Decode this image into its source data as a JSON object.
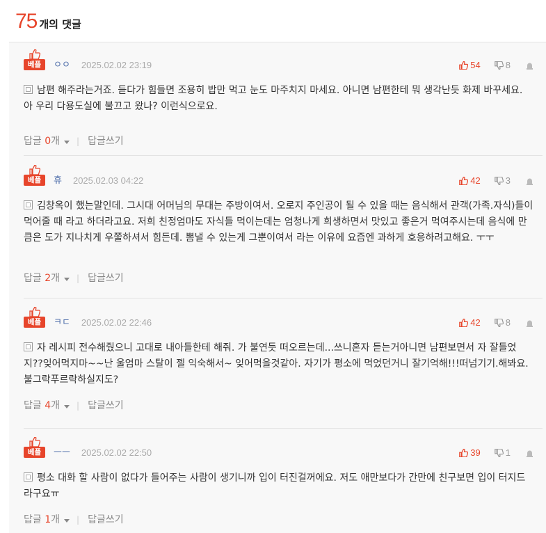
{
  "header": {
    "count": "75",
    "label": "개의 댓글"
  },
  "comments": [
    {
      "badge": "베플",
      "author": "ㅇㅇ",
      "date": "2025.02.02 23:19",
      "likes": "54",
      "dislikes": "8",
      "text": "남편 해주라는거죠. 듣다가 힘들면 조용히 밥만 먹고 눈도 마주치지 마세요. 아니면 남편한테 뭐 생각난듯 화제 바꾸세요. 아 우리 다용도실에 불끄고 왔나? 이런식으로요.",
      "reply_label": "답글",
      "reply_count": "0",
      "reply_unit": "개",
      "write_label": "답글쓰기"
    },
    {
      "badge": "베플",
      "author": "휴",
      "date": "2025.02.03 04:22",
      "likes": "42",
      "dislikes": "3",
      "text": "김창옥이 했는말인데. 그시대 어머님의 무대는 주방이여서. 오로지 주인공이 될 수 있을 때는 음식해서 관객(가족.자식)들이 먹어줄 때 라고 하더라고요. 저희 친정엄마도 자식들 먹이는데는 엄청나게 희생하면서 맛있고 좋은거 먹여주시는데 음식에 만큼은 도가 지나치게 우쭐하셔서 힘든데. 뽐낼 수 있는게 그뿐이여서 라는 이유에 요즘엔 과하게 호응하려고해요. ㅜㅜ",
      "reply_label": "답글",
      "reply_count": "2",
      "reply_unit": "개",
      "write_label": "답글쓰기"
    },
    {
      "badge": "베플",
      "author": "ㅋㄷ",
      "date": "2025.02.02 22:46",
      "likes": "42",
      "dislikes": "8",
      "text": "자 레시피 전수해줬으니 고대로 내아들한테 해줘. 가 불연듯 떠오르는데...쓰니혼자 듣는거아니면 남편보면서 자 잘들었지??잊어먹지마~~난 울엄마 스탈이 젤 익숙해서~ 잊어먹을것같아. 자기가 평소에 먹었던거니 잘기억해!!!떠넘기기.해봐요. 불그락푸르락하실지도?",
      "reply_label": "답글",
      "reply_count": "4",
      "reply_unit": "개",
      "write_label": "답글쓰기"
    },
    {
      "badge": "베플",
      "author": "ㅡㅡ",
      "date": "2025.02.02 22:50",
      "likes": "39",
      "dislikes": "1",
      "text": "평소 대화 할 사람이 없다가 들어주는 사람이 생기니까 입이 터진걸꺼에요. 저도 애만보다가 간만에 친구보면 입이 터지드라구요ㅠ",
      "reply_label": "답글",
      "reply_count": "1",
      "reply_unit": "개",
      "write_label": "답글쓰기"
    }
  ],
  "colors": {
    "accent": "#e7452b",
    "author": "#4a6aa8",
    "muted": "#999999"
  },
  "icons": {
    "best": "thumbs-up-icon",
    "like": "thumbs-up-icon",
    "dislike": "thumbs-down-icon",
    "report": "siren-icon",
    "body": "document-icon",
    "expand": "chevron-down-icon"
  }
}
